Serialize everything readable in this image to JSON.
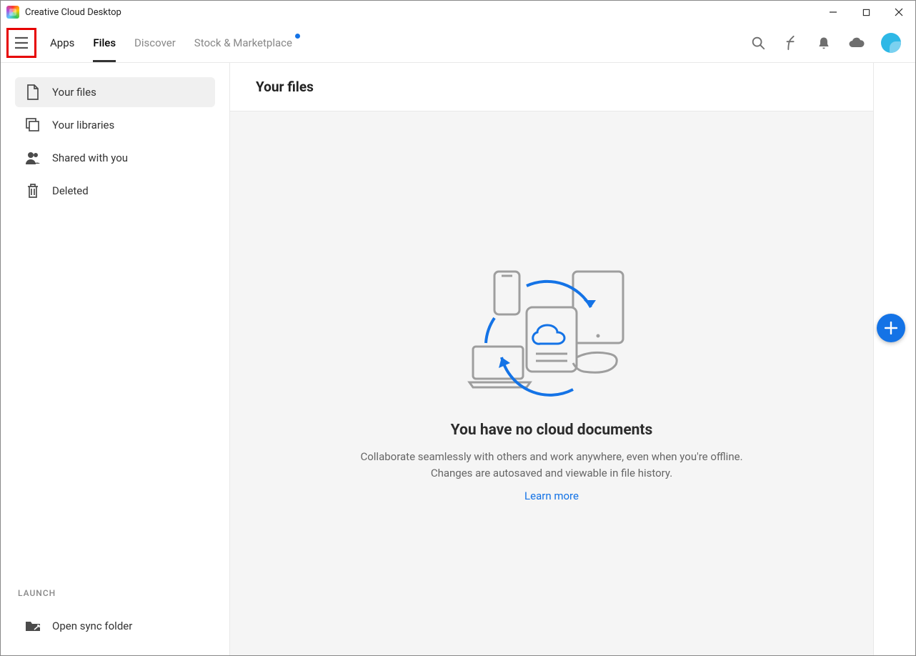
{
  "window": {
    "title": "Creative Cloud Desktop"
  },
  "nav": {
    "tabs": [
      {
        "label": "Apps"
      },
      {
        "label": "Files"
      },
      {
        "label": "Discover"
      },
      {
        "label": "Stock & Marketplace"
      }
    ]
  },
  "sidebar": {
    "items": [
      {
        "label": "Your files"
      },
      {
        "label": "Your libraries"
      },
      {
        "label": "Shared with you"
      },
      {
        "label": "Deleted"
      }
    ],
    "launch_label": "LAUNCH",
    "open_sync": "Open sync folder"
  },
  "main": {
    "header": "Your files",
    "empty_title": "You have no cloud documents",
    "empty_subtitle": "Collaborate seamlessly with others and work anywhere, even when you're offline. Changes are autosaved and viewable in file history.",
    "learn_more": "Learn more"
  }
}
